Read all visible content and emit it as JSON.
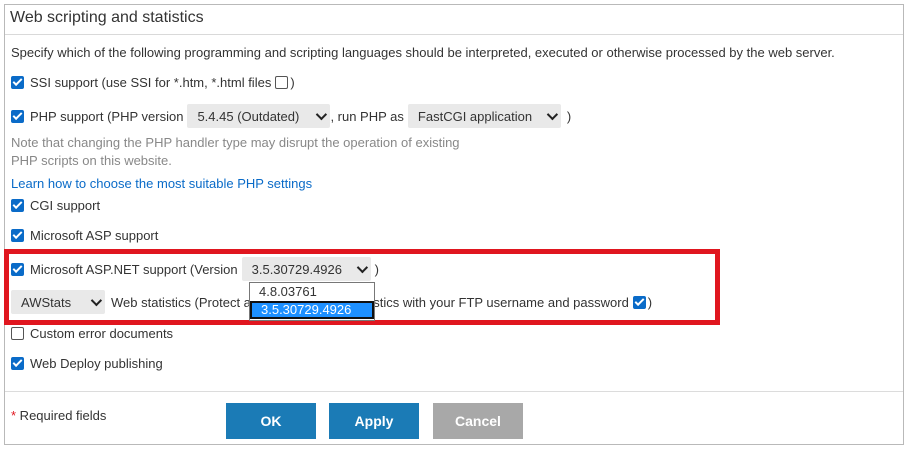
{
  "section": {
    "title": "Web scripting and statistics",
    "description": "Specify which of the following programming and scripting languages should be interpreted, executed or otherwise processed by the web server."
  },
  "ssi": {
    "label": "SSI support (use SSI for *.htm, *.html files",
    "close": ")",
    "checked": true,
    "htm_checked": false
  },
  "php": {
    "label": "PHP support (PHP version",
    "version": "5.4.45 (Outdated)",
    "run_as_label": ", run PHP as",
    "handler": "FastCGI application",
    "close": ")",
    "checked": true,
    "note_line1": "Note that changing the PHP handler type may disrupt the operation of existing",
    "note_line2": "PHP scripts on this website.",
    "link": "Learn how to choose the most suitable PHP settings"
  },
  "cgi": {
    "label": "CGI support",
    "checked": true
  },
  "asp": {
    "label": "Microsoft ASP support",
    "checked": true
  },
  "aspnet": {
    "label": "Microsoft ASP.NET support (Version",
    "version": "3.5.30729.4926",
    "close": ")",
    "checked": true,
    "options": [
      "4.8.03761",
      "3.5.30729.4926"
    ],
    "selected_index": 1
  },
  "stats": {
    "engine": "AWStats",
    "label_left": "Web statistics (Protect a",
    "label_right": "tatistics with your FTP username and password",
    "close": ")",
    "protect_checked": true
  },
  "custom_errors": {
    "label": "Custom error documents",
    "checked": false
  },
  "web_deploy": {
    "label": "Web Deploy publishing",
    "checked": true
  },
  "footer": {
    "required_star": "*",
    "required_text": " Required fields",
    "ok": "OK",
    "apply": "Apply",
    "cancel": "Cancel"
  },
  "colors": {
    "accent": "#0a6bc8",
    "button": "#1b7bb6",
    "highlight": "#e0161f",
    "selection": "#1e90ff"
  }
}
